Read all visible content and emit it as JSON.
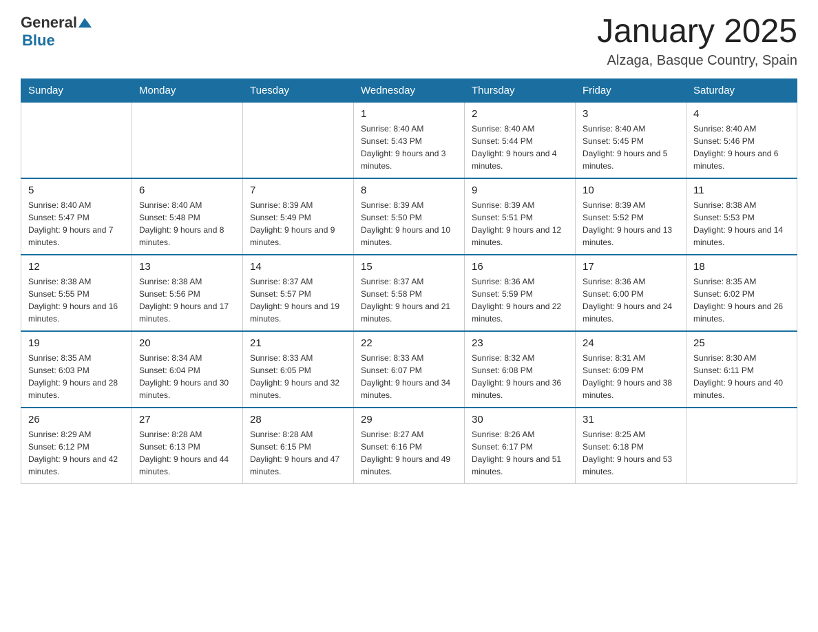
{
  "header": {
    "logo_general": "General",
    "logo_blue": "Blue",
    "title": "January 2025",
    "location": "Alzaga, Basque Country, Spain"
  },
  "weekdays": [
    "Sunday",
    "Monday",
    "Tuesday",
    "Wednesday",
    "Thursday",
    "Friday",
    "Saturday"
  ],
  "weeks": [
    [
      {
        "day": "",
        "info": ""
      },
      {
        "day": "",
        "info": ""
      },
      {
        "day": "",
        "info": ""
      },
      {
        "day": "1",
        "info": "Sunrise: 8:40 AM\nSunset: 5:43 PM\nDaylight: 9 hours and 3 minutes."
      },
      {
        "day": "2",
        "info": "Sunrise: 8:40 AM\nSunset: 5:44 PM\nDaylight: 9 hours and 4 minutes."
      },
      {
        "day": "3",
        "info": "Sunrise: 8:40 AM\nSunset: 5:45 PM\nDaylight: 9 hours and 5 minutes."
      },
      {
        "day": "4",
        "info": "Sunrise: 8:40 AM\nSunset: 5:46 PM\nDaylight: 9 hours and 6 minutes."
      }
    ],
    [
      {
        "day": "5",
        "info": "Sunrise: 8:40 AM\nSunset: 5:47 PM\nDaylight: 9 hours and 7 minutes."
      },
      {
        "day": "6",
        "info": "Sunrise: 8:40 AM\nSunset: 5:48 PM\nDaylight: 9 hours and 8 minutes."
      },
      {
        "day": "7",
        "info": "Sunrise: 8:39 AM\nSunset: 5:49 PM\nDaylight: 9 hours and 9 minutes."
      },
      {
        "day": "8",
        "info": "Sunrise: 8:39 AM\nSunset: 5:50 PM\nDaylight: 9 hours and 10 minutes."
      },
      {
        "day": "9",
        "info": "Sunrise: 8:39 AM\nSunset: 5:51 PM\nDaylight: 9 hours and 12 minutes."
      },
      {
        "day": "10",
        "info": "Sunrise: 8:39 AM\nSunset: 5:52 PM\nDaylight: 9 hours and 13 minutes."
      },
      {
        "day": "11",
        "info": "Sunrise: 8:38 AM\nSunset: 5:53 PM\nDaylight: 9 hours and 14 minutes."
      }
    ],
    [
      {
        "day": "12",
        "info": "Sunrise: 8:38 AM\nSunset: 5:55 PM\nDaylight: 9 hours and 16 minutes."
      },
      {
        "day": "13",
        "info": "Sunrise: 8:38 AM\nSunset: 5:56 PM\nDaylight: 9 hours and 17 minutes."
      },
      {
        "day": "14",
        "info": "Sunrise: 8:37 AM\nSunset: 5:57 PM\nDaylight: 9 hours and 19 minutes."
      },
      {
        "day": "15",
        "info": "Sunrise: 8:37 AM\nSunset: 5:58 PM\nDaylight: 9 hours and 21 minutes."
      },
      {
        "day": "16",
        "info": "Sunrise: 8:36 AM\nSunset: 5:59 PM\nDaylight: 9 hours and 22 minutes."
      },
      {
        "day": "17",
        "info": "Sunrise: 8:36 AM\nSunset: 6:00 PM\nDaylight: 9 hours and 24 minutes."
      },
      {
        "day": "18",
        "info": "Sunrise: 8:35 AM\nSunset: 6:02 PM\nDaylight: 9 hours and 26 minutes."
      }
    ],
    [
      {
        "day": "19",
        "info": "Sunrise: 8:35 AM\nSunset: 6:03 PM\nDaylight: 9 hours and 28 minutes."
      },
      {
        "day": "20",
        "info": "Sunrise: 8:34 AM\nSunset: 6:04 PM\nDaylight: 9 hours and 30 minutes."
      },
      {
        "day": "21",
        "info": "Sunrise: 8:33 AM\nSunset: 6:05 PM\nDaylight: 9 hours and 32 minutes."
      },
      {
        "day": "22",
        "info": "Sunrise: 8:33 AM\nSunset: 6:07 PM\nDaylight: 9 hours and 34 minutes."
      },
      {
        "day": "23",
        "info": "Sunrise: 8:32 AM\nSunset: 6:08 PM\nDaylight: 9 hours and 36 minutes."
      },
      {
        "day": "24",
        "info": "Sunrise: 8:31 AM\nSunset: 6:09 PM\nDaylight: 9 hours and 38 minutes."
      },
      {
        "day": "25",
        "info": "Sunrise: 8:30 AM\nSunset: 6:11 PM\nDaylight: 9 hours and 40 minutes."
      }
    ],
    [
      {
        "day": "26",
        "info": "Sunrise: 8:29 AM\nSunset: 6:12 PM\nDaylight: 9 hours and 42 minutes."
      },
      {
        "day": "27",
        "info": "Sunrise: 8:28 AM\nSunset: 6:13 PM\nDaylight: 9 hours and 44 minutes."
      },
      {
        "day": "28",
        "info": "Sunrise: 8:28 AM\nSunset: 6:15 PM\nDaylight: 9 hours and 47 minutes."
      },
      {
        "day": "29",
        "info": "Sunrise: 8:27 AM\nSunset: 6:16 PM\nDaylight: 9 hours and 49 minutes."
      },
      {
        "day": "30",
        "info": "Sunrise: 8:26 AM\nSunset: 6:17 PM\nDaylight: 9 hours and 51 minutes."
      },
      {
        "day": "31",
        "info": "Sunrise: 8:25 AM\nSunset: 6:18 PM\nDaylight: 9 hours and 53 minutes."
      },
      {
        "day": "",
        "info": ""
      }
    ]
  ]
}
